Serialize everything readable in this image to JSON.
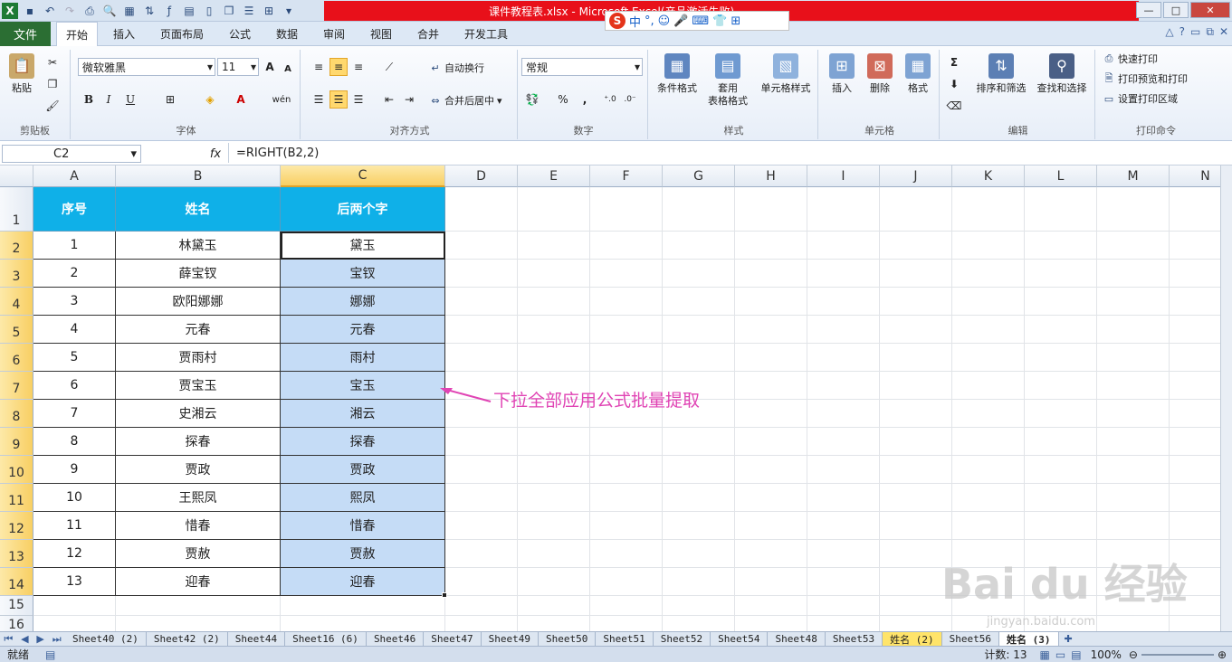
{
  "window": {
    "title": "课件教程表.xlsx - Microsoft Excel(产品激活失败)",
    "ime_label": "中",
    "ime_extras": "°,",
    "controls": [
      "—",
      "□",
      "✕"
    ]
  },
  "ribbon_tabs": [
    "文件",
    "开始",
    "插入",
    "页面布局",
    "公式",
    "数据",
    "审阅",
    "视图",
    "合并",
    "开发工具"
  ],
  "ribbon": {
    "clipboard": {
      "paste": "粘贴",
      "label": "剪贴板"
    },
    "font": {
      "name": "微软雅黑",
      "size": "11",
      "label": "字体",
      "bold": "B",
      "italic": "I",
      "underline": "U",
      "grow": "A",
      "shrink": "A",
      "font_color": "A",
      "phonetic": "wén"
    },
    "alignment": {
      "wrap": "自动换行",
      "merge": "合并后居中",
      "label": "对齐方式"
    },
    "number": {
      "format": "常规",
      "label": "数字",
      "percent": "%",
      "comma": ","
    },
    "styles": {
      "conditional": "条件格式",
      "table1": "套用",
      "table2": "表格格式",
      "cell_styles": "单元格样式",
      "label": "样式"
    },
    "cells": {
      "insert": "插入",
      "delete": "删除",
      "format": "格式",
      "label": "单元格"
    },
    "editing": {
      "sort": "排序和筛选",
      "find": "查找和选择",
      "label": "编辑",
      "sum": "Σ"
    },
    "print": {
      "quick": "快速打印",
      "preview": "打印预览和打印",
      "area": "设置打印区域",
      "label": "打印命令"
    }
  },
  "formula_bar": {
    "name_box": "C2",
    "fx": "fx",
    "formula": "=RIGHT(B2,2)"
  },
  "columns": [
    "A",
    "B",
    "C",
    "D",
    "E",
    "F",
    "G",
    "H",
    "I",
    "J",
    "K",
    "L",
    "M",
    "N"
  ],
  "rows": [
    "1",
    "2",
    "3",
    "4",
    "5",
    "6",
    "7",
    "8",
    "9",
    "10",
    "11",
    "12",
    "13",
    "14",
    "15",
    "16"
  ],
  "table": {
    "headers": [
      "序号",
      "姓名",
      "后两个字"
    ],
    "data": [
      [
        "1",
        "林黛玉",
        "黛玉"
      ],
      [
        "2",
        "薛宝钗",
        "宝钗"
      ],
      [
        "3",
        "欧阳娜娜",
        "娜娜"
      ],
      [
        "4",
        "元春",
        "元春"
      ],
      [
        "5",
        "贾雨村",
        "雨村"
      ],
      [
        "6",
        "贾宝玉",
        "宝玉"
      ],
      [
        "7",
        "史湘云",
        "湘云"
      ],
      [
        "8",
        "探春",
        "探春"
      ],
      [
        "9",
        "贾政",
        "贾政"
      ],
      [
        "10",
        "王熙凤",
        "熙凤"
      ],
      [
        "11",
        "惜春",
        "惜春"
      ],
      [
        "12",
        "贾赦",
        "贾赦"
      ],
      [
        "13",
        "迎春",
        "迎春"
      ]
    ]
  },
  "annotation": "下拉全部应用公式批量提取",
  "sheet_tabs": [
    "Sheet40 (2)",
    "Sheet42 (2)",
    "Sheet44",
    "Sheet16 (6)",
    "Sheet46",
    "Sheet47",
    "Sheet49",
    "Sheet50",
    "Sheet51",
    "Sheet52",
    "Sheet54",
    "Sheet48",
    "Sheet53",
    "姓名 (2)",
    "Sheet56",
    "姓名 (3)"
  ],
  "active_sheet": "姓名 (3)",
  "status": {
    "ready": "就绪",
    "count": "计数: 13",
    "zoom": "100%"
  },
  "watermark": {
    "text": "Bai du 经验",
    "url": "jingyan.baidu.com"
  }
}
